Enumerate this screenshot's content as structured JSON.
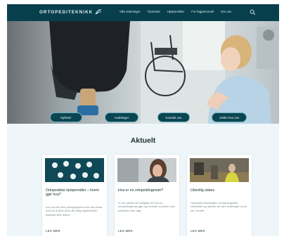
{
  "header": {
    "logo_text": "ORTOPEDITEKNIKK",
    "nav": [
      "Vårt avdelinger",
      "Tjenester",
      "Hjelpemidler",
      "For fagpersonell",
      "Om oss"
    ]
  },
  "hero": {
    "buttons": [
      "Nyheter",
      "Avdelinger",
      "Kontakt oss",
      "Jobbe hos oss"
    ]
  },
  "section": {
    "title": "Aktuelt"
  },
  "cards": [
    {
      "title": "Ortopediske hjelpemidler – hvem gjør hva?",
      "text": "Les hva de ulike yrkesgruppene hos oss bidrar med for å sikre at du får riktig hjelpemiddel tilpasset dine behov.",
      "link": "LES MER"
    },
    {
      "title": "Hva er en ortopediingeniør?",
      "text": "Vi har samlet det viktigste om hva en ortopediingeniør gjør og hvordan vi jobber med pasienter hver dag.",
      "link": "LES MER"
    },
    {
      "title": "Ukentlig status",
      "text": "Oppdatert informasjon om åpningstider, ventetider og nyheter fra våre avdelinger rundt om i landet.",
      "link": "LES MER"
    }
  ],
  "colors": {
    "header_bg": "#083f4c",
    "pill_bg": "#0a4552",
    "page_bg": "#eef6f9"
  }
}
